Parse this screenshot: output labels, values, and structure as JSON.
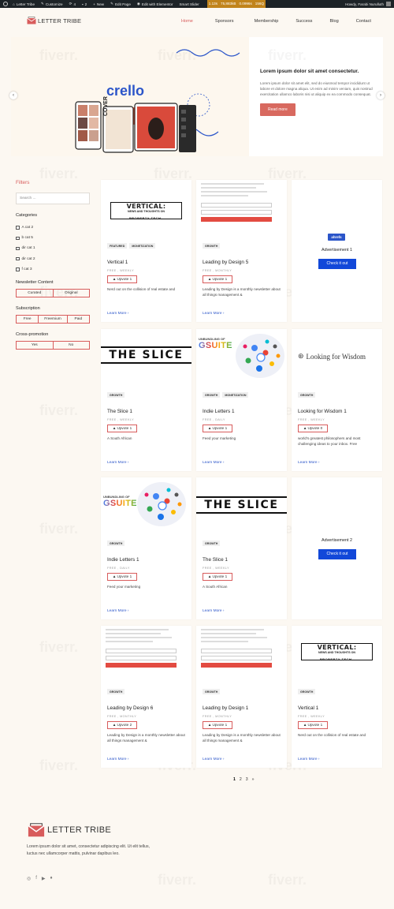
{
  "admin_bar": {
    "items": [
      "Letter Tribe",
      "Customize",
      "4",
      "2",
      "New",
      "Edit Page",
      "Edit with Elementor",
      "Smart Slider"
    ],
    "perf": [
      "1.13s",
      "75,883kB",
      "0.0996s",
      "156Q"
    ],
    "howdy": "Howdy, Farabi Nurulluth"
  },
  "site": {
    "logo_text": "LETTER TRIBE",
    "nav": [
      "Home",
      "Sponsors",
      "Membership",
      "Success",
      "Blog",
      "Contact"
    ]
  },
  "slider": {
    "image_brand": "crello",
    "image_caption": "COVER",
    "title": "Lorem ipsum dolor sit amet consectetur.",
    "body": "Lorem ipsum dolor sit amet elit, sed do eiusmod tempor incididunt ut labore et dolore magna aliqua. Ut enim ad minim veniam, quis nostrud exercitation ullamco laboris nisi ut aliquip ex ea commodo consequat.",
    "button": "Read more",
    "prev": "‹",
    "next": "›"
  },
  "watermark": "fiverr.",
  "filters": {
    "title": "Filters",
    "search_placeholder": "Search ...",
    "categories_label": "Categories",
    "categories": [
      "A cat 2",
      "b cat 5",
      "dir cat 1",
      "dir cat 2",
      "f cat 3"
    ],
    "newsletter_label": "Newsletter Content",
    "newsletter_options": [
      "Curated",
      "Original"
    ],
    "subscription_label": "Subscription",
    "subscription_options": [
      "Free",
      "Freemium",
      "Paid"
    ],
    "cross_label": "Cross-promotion",
    "cross_options": [
      "Yes",
      "No"
    ]
  },
  "image_text": {
    "vertical_a": "VERTICAL:",
    "vertical_b": "NEWS AND THOUGHTS ON",
    "vertical_c": "PROPERTY TECH",
    "slice": "THE SLICE",
    "gsuite_a": "UNBUNDLING OF",
    "gsuite_b": "GSUITE",
    "wisdom": "Looking for Wisdom",
    "ahrefs": "ahrefs"
  },
  "cards": [
    {
      "tags": [
        "FEATURED",
        "MONETIZATION"
      ],
      "title": "Vertical 1",
      "meta": "FREE , WEEKLY",
      "upvote": "Upvote 1",
      "desc": "Nerd out on the collision of real estate and",
      "learn": "Learn More ›"
    },
    {
      "tags": [
        "GROWTH"
      ],
      "title": "Leading by Design 5",
      "meta": "FREE , MONTHLY",
      "upvote": "Upvote 1",
      "desc": "Leading by Design is a monthly newsletter about all things management &",
      "learn": "Learn More ›"
    },
    {
      "ad": true,
      "title": "Advertisement 1",
      "button": "Check it out"
    },
    {
      "tags": [
        "GROWTH"
      ],
      "title": "The Slice 1",
      "meta": "FREE , WEEKLY",
      "upvote": "Upvote 1",
      "desc": "A South African",
      "learn": "Learn More ›"
    },
    {
      "tags": [
        "GROWTH",
        "MONETIZATION"
      ],
      "title": "Indie Letters 1",
      "meta": "FREE , DAILY",
      "upvote": "Upvote 1",
      "desc": "Feed your marketing",
      "learn": "Learn More ›"
    },
    {
      "tags": [
        "GROWTH"
      ],
      "title": "Looking for Wisdom 1",
      "meta": "FREE , WEEKLY",
      "upvote": "Upvote 0",
      "desc": "world's greatest philosophers and most challenging ideas to your inbox. Free",
      "learn": "Learn More ›"
    },
    {
      "tags": [
        "GROWTH"
      ],
      "title": "Indie Letters 1",
      "meta": "FREE , DAILY",
      "upvote": "Upvote 1",
      "desc": "Feed your marketing",
      "learn": "Learn More ›"
    },
    {
      "tags": [
        "GROWTH"
      ],
      "title": "The Slice 1",
      "meta": "FREE , WEEKLY",
      "upvote": "Upvote 1",
      "desc": "A South African",
      "learn": "Learn More ›"
    },
    {
      "ad": true,
      "title": "Advertisement 2",
      "button": "Check it out"
    },
    {
      "tags": [
        "GROWTH"
      ],
      "title": "Leading by Design 6",
      "meta": "FREE , MONTHLY",
      "upvote": "Upvote 2",
      "desc": "Leading by Design is a monthly newsletter about all things management &",
      "learn": "Learn More ›"
    },
    {
      "tags": [
        "GROWTH"
      ],
      "title": "Leading by Design 1",
      "meta": "FREE , MONTHLY",
      "upvote": "Upvote 1",
      "desc": "Leading by Design is a monthly newsletter about all things management &",
      "learn": "Learn More ›"
    },
    {
      "tags": [
        "GROWTH"
      ],
      "title": "Vertical 1",
      "meta": "FREE , WEEKLY",
      "upvote": "Upvote 1",
      "desc": "Nerd out on the collision of real estate and",
      "learn": "Learn More ›"
    }
  ],
  "pagination": [
    "1",
    "2",
    "3",
    "»"
  ],
  "footer": {
    "logo_text": "LETTER TRIBE",
    "desc": "Lorem ipsum dolor sit amet, consectetur adipiscing elit. Ut elit tellus, luctus nec ullamcorper mattis, pulvinar dapibus leo.",
    "socials": [
      "instagram-icon",
      "facebook-icon",
      "youtube-icon",
      "twitter-icon"
    ]
  },
  "colors": {
    "accent": "#d85c5c",
    "link": "#2b55c9",
    "ad_button": "#1248d9",
    "admin_bar": "#1d2327"
  }
}
